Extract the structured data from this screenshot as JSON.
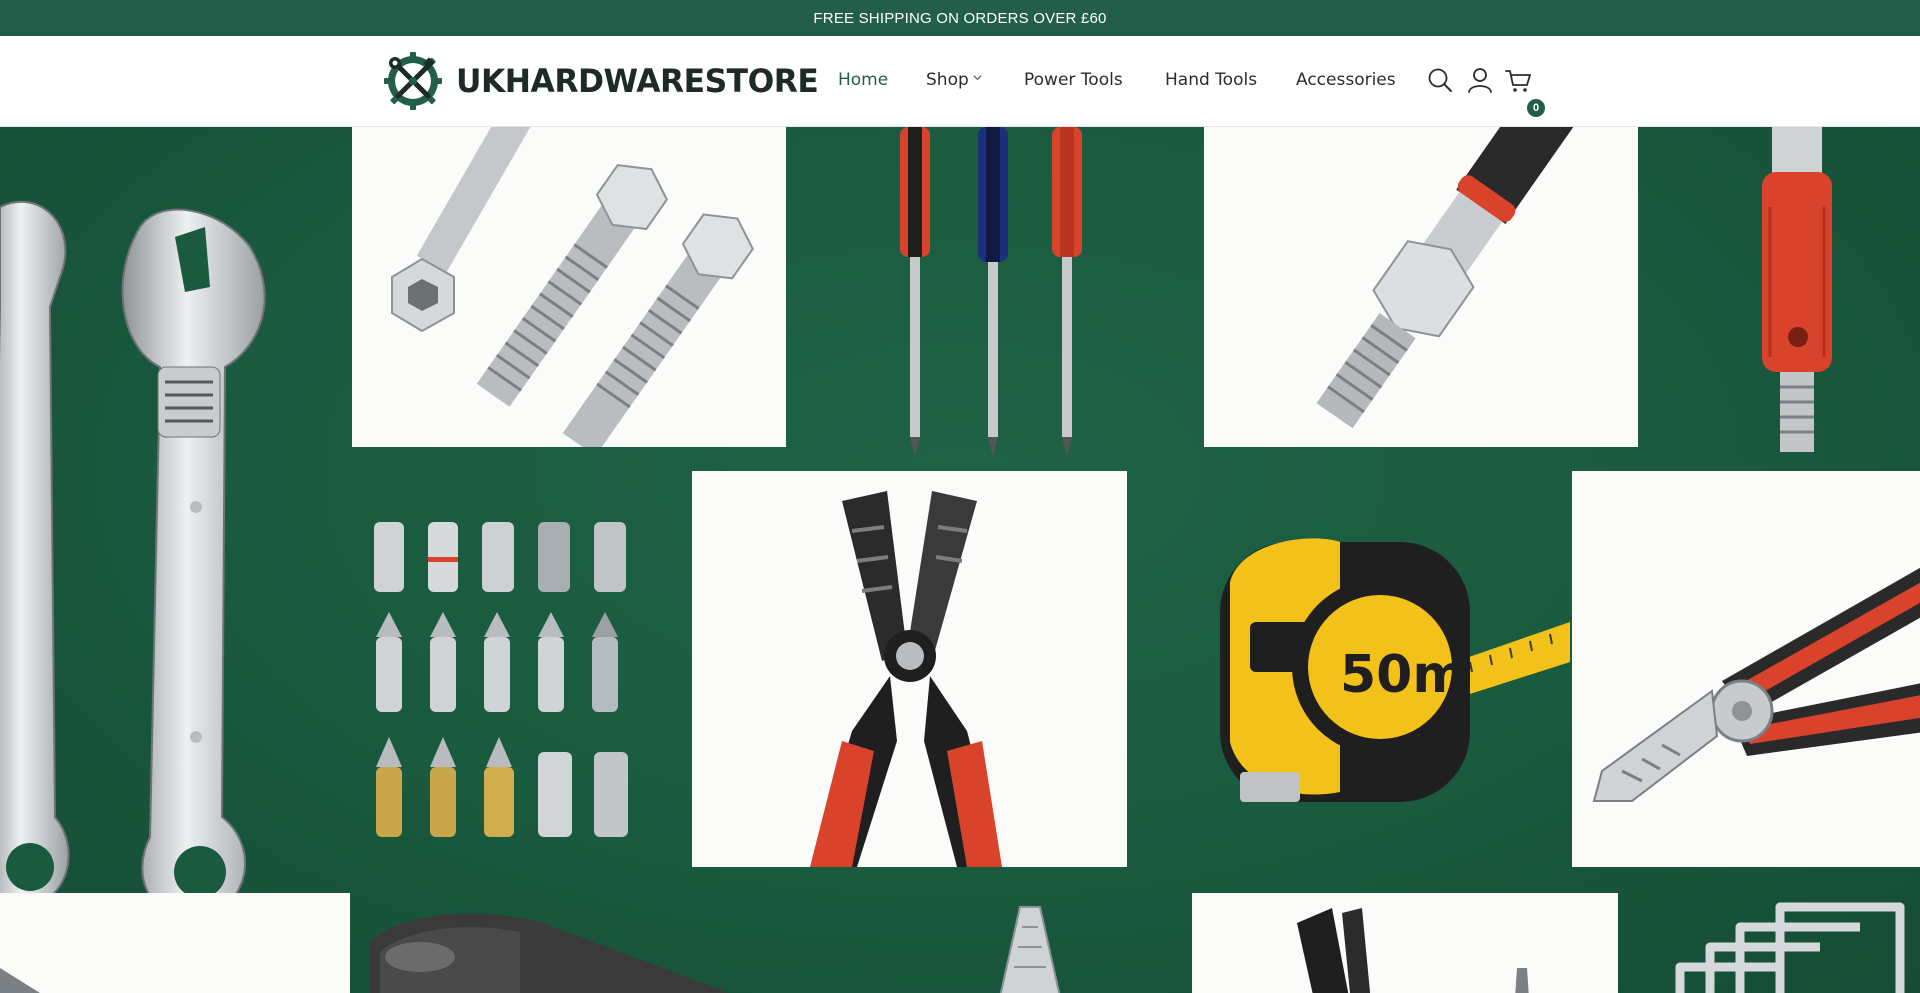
{
  "announcement": {
    "text": "FREE SHIPPING ON ORDERS OVER £60"
  },
  "brand": {
    "name": "UKHARDWARESTORE",
    "emblem_icon": "crossed-tools-emblem-icon"
  },
  "nav": {
    "items": [
      {
        "label": "Home",
        "active": true
      },
      {
        "label": "Shop",
        "has_dropdown": true
      },
      {
        "label": "Power Tools"
      },
      {
        "label": "Hand Tools"
      },
      {
        "label": "Accessories"
      }
    ]
  },
  "header_icons": {
    "search": "search-icon",
    "account": "user-icon",
    "cart": "cart-icon",
    "cart_count": "0"
  },
  "hero": {
    "tape_measure_label": "50m",
    "products": [
      "adjustable-wrenches",
      "hex-bolts",
      "screwdrivers",
      "threaded-bolt",
      "red-handle-tool",
      "bit-sockets",
      "wire-crimpers",
      "tape-measure",
      "pliers",
      "hammer",
      "needle-nose-pliers",
      "crimping-tool",
      "hex-key-set"
    ]
  },
  "colors": {
    "brand_green": "#235e4b",
    "hero_green": "#1a5a3f",
    "accent_red": "#d9432c",
    "tape_yellow": "#f2c21a"
  }
}
